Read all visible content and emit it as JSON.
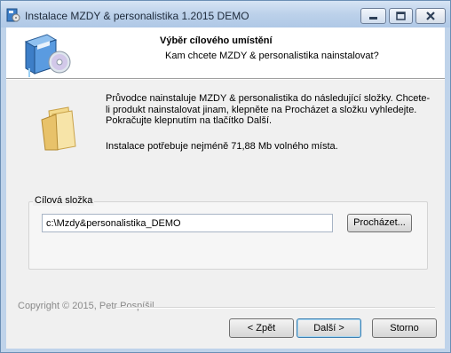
{
  "window": {
    "title": "Instalace MZDY & personalistika 1.2015 DEMO",
    "icon": "installer-app-icon"
  },
  "title_controls": {
    "minimize_icon": "minimize-icon",
    "maximize_icon": "maximize-icon",
    "close_icon": "close-icon"
  },
  "header": {
    "title": "Výběr cílového umístění",
    "subtitle": "Kam chcete MZDY & personalistika nainstalovat?",
    "icon": "install-setup-icon"
  },
  "body": {
    "folder_icon": "folder-icon",
    "description": "Průvodce nainstaluje MZDY & personalistika do následující složky. Chcete-li produkt nainstalovat jinam, klepněte na Procházet a složku vyhledejte. Pokračujte klepnutím na tlačítko Další.",
    "space_required": "Instalace potřebuje nejméně 71,88 Mb volného místa."
  },
  "destination": {
    "group_label": "Cílová složka",
    "path_value": "c:\\Mzdy&personalistika_DEMO",
    "browse_label": "Procházet..."
  },
  "footer": {
    "copyright": "Copyright © 2015, Petr Pospíšil",
    "back_label": "< Zpět",
    "next_label": "Další >",
    "cancel_label": "Storno"
  },
  "colors": {
    "titlebar": "#bcd1ea",
    "accent_border": "#3c7fb1",
    "dialog_bg": "#f0f0f0"
  }
}
